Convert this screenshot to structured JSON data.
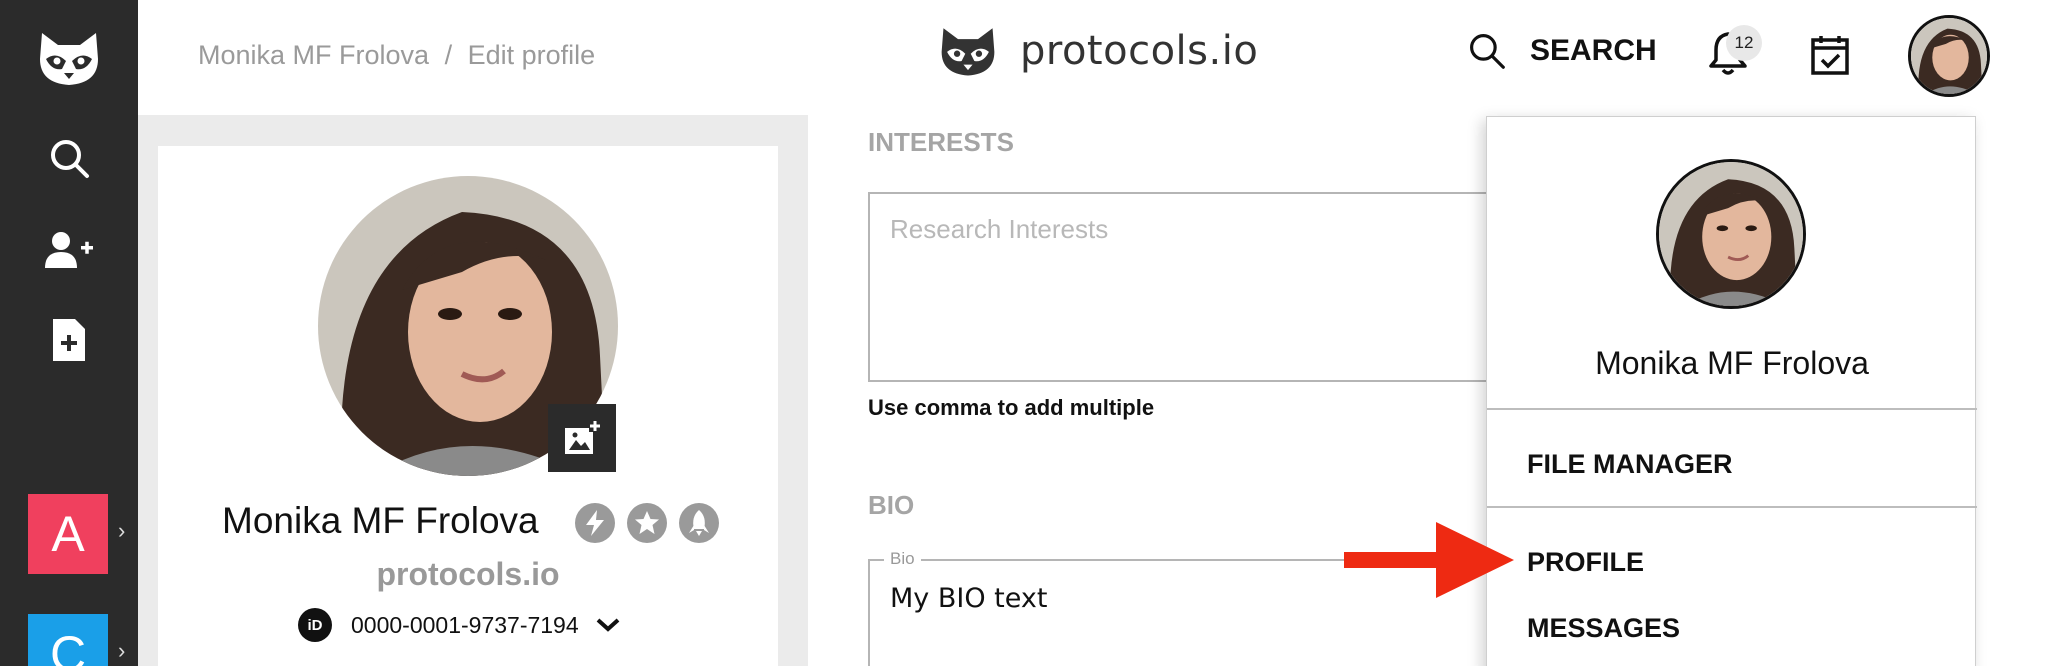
{
  "sidebar": {
    "icons": [
      "raccoon-logo-icon",
      "search-icon",
      "add-user-icon",
      "add-file-icon"
    ],
    "workspaces": [
      {
        "letter": "A",
        "color": "#f0405e"
      },
      {
        "letter": "C",
        "color": "#1a9fe8"
      }
    ]
  },
  "header": {
    "breadcrumb": {
      "user": "Monika MF Frolova",
      "separator": "/",
      "page": "Edit profile"
    },
    "brand": "protocols.io",
    "search_label": "SEARCH",
    "notification_count": "12"
  },
  "profile_card": {
    "name": "Monika MF Frolova",
    "organization": "protocols.io",
    "orcid": "0000-0001-9737-7194",
    "orcid_label": "iD",
    "badges": [
      "lightning-badge-icon",
      "star-badge-icon",
      "rocket-badge-icon"
    ]
  },
  "form": {
    "interests_heading": "INTERESTS",
    "interests_placeholder": "Research Interests",
    "interests_help": "Use comma to add multiple",
    "bio_heading": "BIO",
    "bio_label": "Bio",
    "bio_value": "My BIO text"
  },
  "user_menu": {
    "name": "Monika MF Frolova",
    "items": [
      "FILE MANAGER",
      "PROFILE",
      "MESSAGES"
    ]
  },
  "colors": {
    "rail": "#2b2b2b",
    "accent_arrow": "#ee2a12",
    "workspace_a": "#f0405e",
    "workspace_c": "#1a9fe8"
  }
}
